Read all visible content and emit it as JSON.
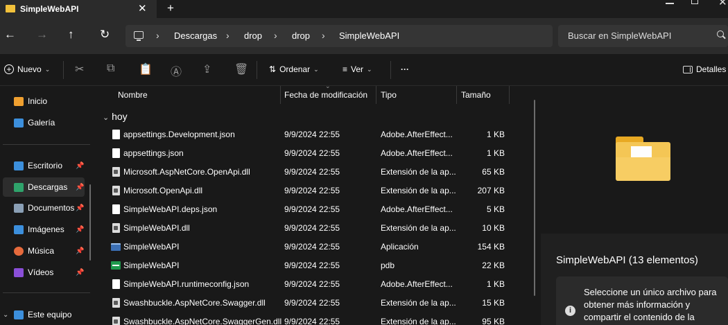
{
  "window": {
    "tab_title": "SimpleWebAPI",
    "tab_close": "✕",
    "tab_new": "+"
  },
  "navigation": {
    "back": "←",
    "forward": "→",
    "up": "↑",
    "refresh": "↻",
    "breadcrumb": [
      "Descargas",
      "drop",
      "drop",
      "SimpleWebAPI"
    ],
    "search_placeholder": "Buscar en SimpleWebAPI"
  },
  "commandbar": {
    "new_label": "Nuevo",
    "sort_label": "Ordenar",
    "view_label": "Ver",
    "more_label": "···",
    "details_label": "Detalles"
  },
  "sidebar": {
    "items": [
      {
        "label": "Inicio",
        "icon": "home-icon",
        "color": "#f0a030"
      },
      {
        "label": "Galería",
        "icon": "gallery-icon",
        "color": "#3c8fdc"
      },
      {
        "label": "Escritorio",
        "icon": "desktop-icon",
        "color": "#3c8fdc",
        "pinned": true
      },
      {
        "label": "Descargas",
        "icon": "download-icon",
        "color": "#2fa36b",
        "pinned": true,
        "selected": true
      },
      {
        "label": "Documentos",
        "icon": "documents-icon",
        "color": "#8a9fb5",
        "pinned": true
      },
      {
        "label": "Imágenes",
        "icon": "pictures-icon",
        "color": "#3c8fdc",
        "pinned": true
      },
      {
        "label": "Música",
        "icon": "music-icon",
        "color": "#e66a3c",
        "pinned": true
      },
      {
        "label": "Vídeos",
        "icon": "videos-icon",
        "color": "#8a4fd8",
        "pinned": true
      },
      {
        "label": "Este equipo",
        "icon": "pc-icon",
        "color": "#3c8fdc"
      }
    ]
  },
  "filelist": {
    "columns": [
      "Nombre",
      "Fecha de modificación",
      "Tipo",
      "Tamaño"
    ],
    "group": "hoy",
    "rows": [
      {
        "name": "appsettings.Development.json",
        "date": "9/9/2024 22:55",
        "type": "Adobe.AfterEffect...",
        "size": "1 KB",
        "icon": "file-icon"
      },
      {
        "name": "appsettings.json",
        "date": "9/9/2024 22:55",
        "type": "Adobe.AfterEffect...",
        "size": "1 KB",
        "icon": "file-icon"
      },
      {
        "name": "Microsoft.AspNetCore.OpenApi.dll",
        "date": "9/9/2024 22:55",
        "type": "Extensión de la ap...",
        "size": "65 KB",
        "icon": "dll-icon"
      },
      {
        "name": "Microsoft.OpenApi.dll",
        "date": "9/9/2024 22:55",
        "type": "Extensión de la ap...",
        "size": "207 KB",
        "icon": "dll-icon"
      },
      {
        "name": "SimpleWebAPI.deps.json",
        "date": "9/9/2024 22:55",
        "type": "Adobe.AfterEffect...",
        "size": "5 KB",
        "icon": "file-icon"
      },
      {
        "name": "SimpleWebAPI.dll",
        "date": "9/9/2024 22:55",
        "type": "Extensión de la ap...",
        "size": "10 KB",
        "icon": "dll-icon"
      },
      {
        "name": "SimpleWebAPI",
        "date": "9/9/2024 22:55",
        "type": "Aplicación",
        "size": "154 KB",
        "icon": "app-icon"
      },
      {
        "name": "SimpleWebAPI",
        "date": "9/9/2024 22:55",
        "type": "pdb",
        "size": "22 KB",
        "icon": "pdb-icon"
      },
      {
        "name": "SimpleWebAPI.runtimeconfig.json",
        "date": "9/9/2024 22:55",
        "type": "Adobe.AfterEffect...",
        "size": "1 KB",
        "icon": "file-icon"
      },
      {
        "name": "Swashbuckle.AspNetCore.Swagger.dll",
        "date": "9/9/2024 22:55",
        "type": "Extensión de la ap...",
        "size": "15 KB",
        "icon": "dll-icon"
      },
      {
        "name": "Swashbuckle.AspNetCore.SwaggerGen.dll",
        "date": "9/9/2024 22:55",
        "type": "Extensión de la ap...",
        "size": "95 KB",
        "icon": "dll-icon"
      }
    ]
  },
  "details": {
    "title": "SimpleWebAPI (13 elementos)",
    "info": "Seleccione un único archivo para obtener más información y compartir el contenido de la"
  }
}
